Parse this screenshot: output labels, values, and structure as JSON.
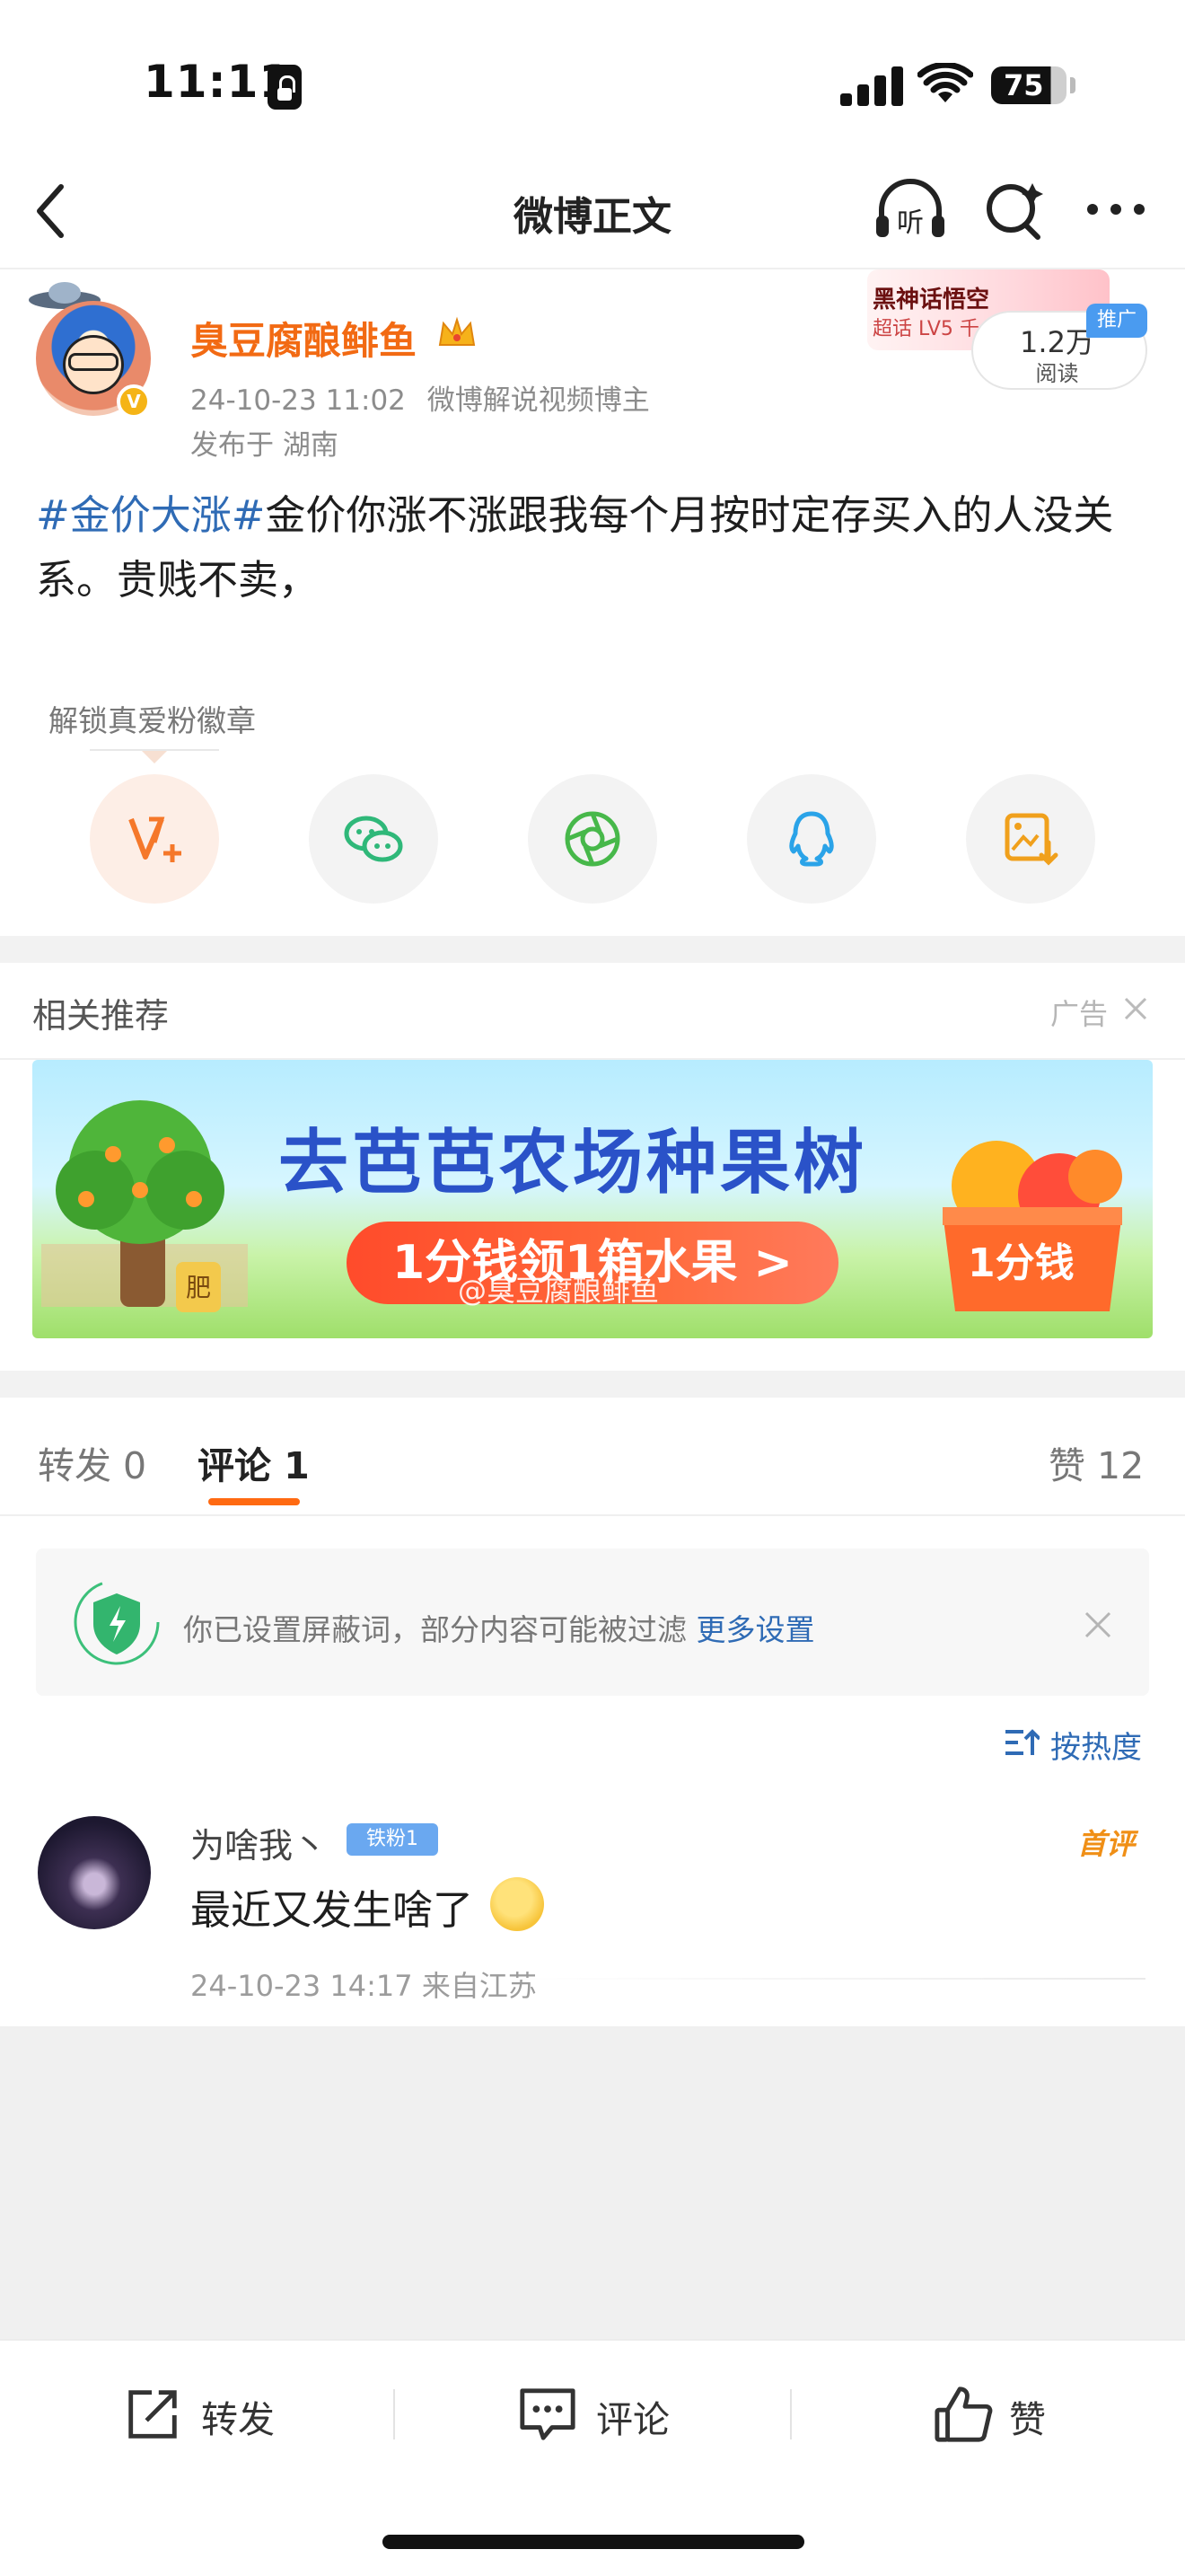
{
  "status_bar": {
    "time": "11:11",
    "battery": "75"
  },
  "nav": {
    "title": "微博正文",
    "listen_label": "听"
  },
  "author": {
    "name": "臭豆腐酿鲱鱼",
    "time": "24-10-23 11:02",
    "role": "微博解说视频博主",
    "location": "发布于 湖南",
    "promo_title": "黑神话悟空",
    "promo_sub": "超话 LV5 千",
    "read_count": "1.2万",
    "read_label": "阅读",
    "ad_badge": "推广"
  },
  "post": {
    "topic": "#金价大涨#",
    "text": "金价你涨不涨跟我每个月按时定存买入的人没关系。贵贱不卖，"
  },
  "share": {
    "unlock_label": "解锁真爱粉徽章"
  },
  "related": {
    "title": "相关推荐",
    "ad_label": "广告",
    "banner_title": "去芭芭农场种果树",
    "banner_button": "1分钱领1箱水果 >",
    "banner_box": "1分钱",
    "banner_tree_tag": "肥",
    "watermark": "@臭豆腐酿鲱鱼"
  },
  "tabs": {
    "repost": "转发 0",
    "comment": "评论 1",
    "like": "赞 12"
  },
  "notice": {
    "text": "你已设置屏蔽词，部分内容可能被过滤 ",
    "link": "更多设置"
  },
  "sort_label": "按热度",
  "comment": {
    "user": "为啥我丶",
    "fan_badge": "铁粉1",
    "first_tag": "首评",
    "text": "最近又发生啥了",
    "meta": "24-10-23 14:17 来自江苏"
  },
  "bottom_bar": {
    "repost": "转发",
    "comment": "评论",
    "like": "赞"
  },
  "colors": {
    "accent": "#ff6a12",
    "link": "#2f6bb5",
    "author": "#f26a13"
  }
}
